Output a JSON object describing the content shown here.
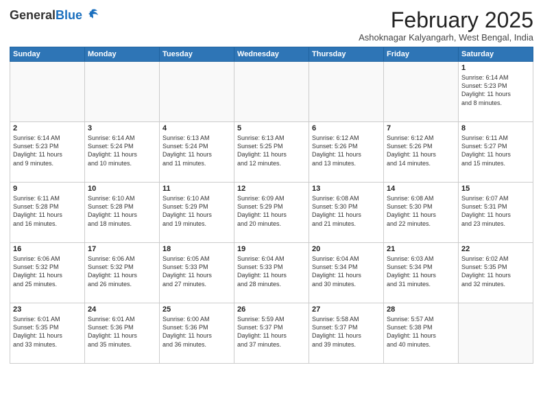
{
  "header": {
    "logo_general": "General",
    "logo_blue": "Blue",
    "month_title": "February 2025",
    "location": "Ashoknagar Kalyangarh, West Bengal, India"
  },
  "weekdays": [
    "Sunday",
    "Monday",
    "Tuesday",
    "Wednesday",
    "Thursday",
    "Friday",
    "Saturday"
  ],
  "weeks": [
    [
      {
        "day": "",
        "info": ""
      },
      {
        "day": "",
        "info": ""
      },
      {
        "day": "",
        "info": ""
      },
      {
        "day": "",
        "info": ""
      },
      {
        "day": "",
        "info": ""
      },
      {
        "day": "",
        "info": ""
      },
      {
        "day": "1",
        "info": "Sunrise: 6:14 AM\nSunset: 5:23 PM\nDaylight: 11 hours\nand 8 minutes."
      }
    ],
    [
      {
        "day": "2",
        "info": "Sunrise: 6:14 AM\nSunset: 5:23 PM\nDaylight: 11 hours\nand 9 minutes."
      },
      {
        "day": "3",
        "info": "Sunrise: 6:14 AM\nSunset: 5:24 PM\nDaylight: 11 hours\nand 10 minutes."
      },
      {
        "day": "4",
        "info": "Sunrise: 6:13 AM\nSunset: 5:24 PM\nDaylight: 11 hours\nand 11 minutes."
      },
      {
        "day": "5",
        "info": "Sunrise: 6:13 AM\nSunset: 5:25 PM\nDaylight: 11 hours\nand 12 minutes."
      },
      {
        "day": "6",
        "info": "Sunrise: 6:12 AM\nSunset: 5:26 PM\nDaylight: 11 hours\nand 13 minutes."
      },
      {
        "day": "7",
        "info": "Sunrise: 6:12 AM\nSunset: 5:26 PM\nDaylight: 11 hours\nand 14 minutes."
      },
      {
        "day": "8",
        "info": "Sunrise: 6:11 AM\nSunset: 5:27 PM\nDaylight: 11 hours\nand 15 minutes."
      }
    ],
    [
      {
        "day": "9",
        "info": "Sunrise: 6:11 AM\nSunset: 5:28 PM\nDaylight: 11 hours\nand 16 minutes."
      },
      {
        "day": "10",
        "info": "Sunrise: 6:10 AM\nSunset: 5:28 PM\nDaylight: 11 hours\nand 18 minutes."
      },
      {
        "day": "11",
        "info": "Sunrise: 6:10 AM\nSunset: 5:29 PM\nDaylight: 11 hours\nand 19 minutes."
      },
      {
        "day": "12",
        "info": "Sunrise: 6:09 AM\nSunset: 5:29 PM\nDaylight: 11 hours\nand 20 minutes."
      },
      {
        "day": "13",
        "info": "Sunrise: 6:08 AM\nSunset: 5:30 PM\nDaylight: 11 hours\nand 21 minutes."
      },
      {
        "day": "14",
        "info": "Sunrise: 6:08 AM\nSunset: 5:30 PM\nDaylight: 11 hours\nand 22 minutes."
      },
      {
        "day": "15",
        "info": "Sunrise: 6:07 AM\nSunset: 5:31 PM\nDaylight: 11 hours\nand 23 minutes."
      }
    ],
    [
      {
        "day": "16",
        "info": "Sunrise: 6:06 AM\nSunset: 5:32 PM\nDaylight: 11 hours\nand 25 minutes."
      },
      {
        "day": "17",
        "info": "Sunrise: 6:06 AM\nSunset: 5:32 PM\nDaylight: 11 hours\nand 26 minutes."
      },
      {
        "day": "18",
        "info": "Sunrise: 6:05 AM\nSunset: 5:33 PM\nDaylight: 11 hours\nand 27 minutes."
      },
      {
        "day": "19",
        "info": "Sunrise: 6:04 AM\nSunset: 5:33 PM\nDaylight: 11 hours\nand 28 minutes."
      },
      {
        "day": "20",
        "info": "Sunrise: 6:04 AM\nSunset: 5:34 PM\nDaylight: 11 hours\nand 30 minutes."
      },
      {
        "day": "21",
        "info": "Sunrise: 6:03 AM\nSunset: 5:34 PM\nDaylight: 11 hours\nand 31 minutes."
      },
      {
        "day": "22",
        "info": "Sunrise: 6:02 AM\nSunset: 5:35 PM\nDaylight: 11 hours\nand 32 minutes."
      }
    ],
    [
      {
        "day": "23",
        "info": "Sunrise: 6:01 AM\nSunset: 5:35 PM\nDaylight: 11 hours\nand 33 minutes."
      },
      {
        "day": "24",
        "info": "Sunrise: 6:01 AM\nSunset: 5:36 PM\nDaylight: 11 hours\nand 35 minutes."
      },
      {
        "day": "25",
        "info": "Sunrise: 6:00 AM\nSunset: 5:36 PM\nDaylight: 11 hours\nand 36 minutes."
      },
      {
        "day": "26",
        "info": "Sunrise: 5:59 AM\nSunset: 5:37 PM\nDaylight: 11 hours\nand 37 minutes."
      },
      {
        "day": "27",
        "info": "Sunrise: 5:58 AM\nSunset: 5:37 PM\nDaylight: 11 hours\nand 39 minutes."
      },
      {
        "day": "28",
        "info": "Sunrise: 5:57 AM\nSunset: 5:38 PM\nDaylight: 11 hours\nand 40 minutes."
      },
      {
        "day": "",
        "info": ""
      }
    ]
  ]
}
